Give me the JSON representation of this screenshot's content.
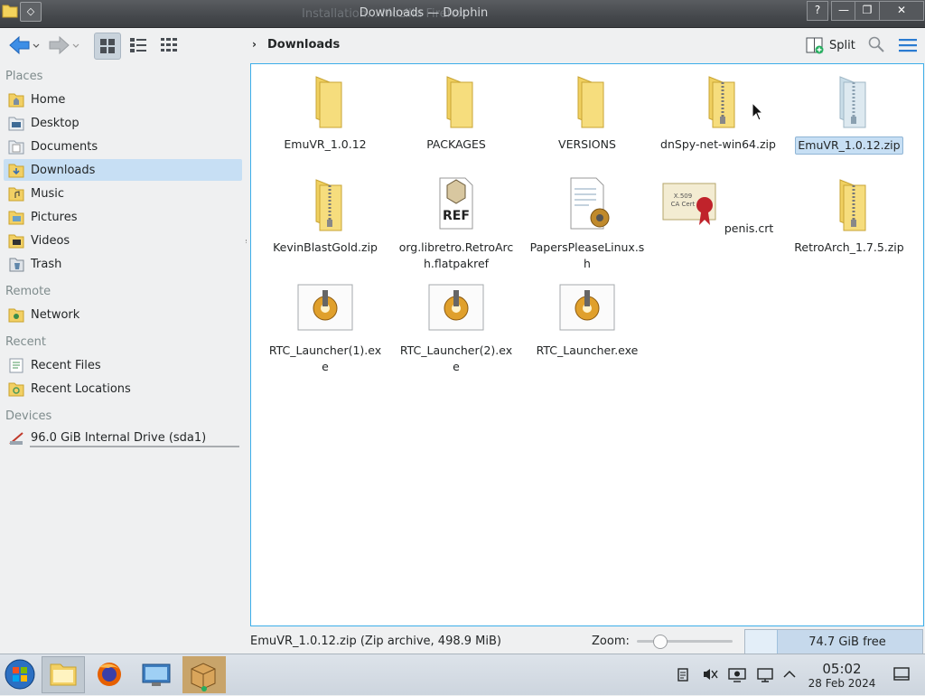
{
  "window": {
    "title": "Downloads — Dolphin",
    "background_title": "Installation... Mozilla Firefox",
    "buttons": {
      "help": "?",
      "minimize": "—",
      "maximize": "❐",
      "close": "✕"
    }
  },
  "toolbar": {
    "breadcrumb": "Downloads",
    "split_label": "Split"
  },
  "places": {
    "sections": {
      "places": "Places",
      "remote": "Remote",
      "recent": "Recent",
      "devices": "Devices"
    },
    "items": [
      {
        "label": "Home",
        "icon": "home-folder-icon"
      },
      {
        "label": "Desktop",
        "icon": "desktop-icon"
      },
      {
        "label": "Documents",
        "icon": "documents-icon"
      },
      {
        "label": "Downloads",
        "icon": "downloads-folder-icon",
        "selected": true
      },
      {
        "label": "Music",
        "icon": "music-folder-icon"
      },
      {
        "label": "Pictures",
        "icon": "pictures-folder-icon"
      },
      {
        "label": "Videos",
        "icon": "videos-folder-icon"
      },
      {
        "label": "Trash",
        "icon": "trash-icon"
      }
    ],
    "remote_items": [
      {
        "label": "Network",
        "icon": "network-icon"
      }
    ],
    "recent_items": [
      {
        "label": "Recent Files",
        "icon": "recent-files-icon"
      },
      {
        "label": "Recent Locations",
        "icon": "recent-locations-icon"
      }
    ],
    "device_items": [
      {
        "label": "96.0 GiB Internal Drive (sda1)",
        "icon": "drive-icon"
      }
    ]
  },
  "files": [
    {
      "name": "EmuVR_1.0.12",
      "type": "folder"
    },
    {
      "name": "PACKAGES",
      "type": "folder"
    },
    {
      "name": "VERSIONS",
      "type": "folder"
    },
    {
      "name": "dnSpy-net-win64.zip",
      "type": "zip"
    },
    {
      "name": "EmuVR_1.0.12.zip",
      "type": "zip",
      "selected": true
    },
    {
      "name": "KevinBlastGold.zip",
      "type": "zip"
    },
    {
      "name": "org.libretro.RetroArch.flatpakref",
      "type": "ref"
    },
    {
      "name": "PapersPleaseLinux.sh",
      "type": "script"
    },
    {
      "name": "penis.crt",
      "type": "cert"
    },
    {
      "name": "RetroArch_1.7.5.zip",
      "type": "zip"
    },
    {
      "name": "RTC_Launcher(1).exe",
      "type": "exe"
    },
    {
      "name": "RTC_Launcher(2).exe",
      "type": "exe"
    },
    {
      "name": "RTC_Launcher.exe",
      "type": "exe"
    }
  ],
  "status": {
    "text": "EmuVR_1.0.12.zip (Zip archive, 498.9 MiB)",
    "zoom_label": "Zoom:",
    "zoom_level": 0.2,
    "free_space": "74.7 GiB free",
    "used_fraction": 0.18
  },
  "taskbar": {
    "time": "05:02",
    "date": "28 Feb 2024"
  },
  "colors": {
    "accent": "#3daee9",
    "selection": "#c7dff4",
    "folder": "#f0d060"
  }
}
